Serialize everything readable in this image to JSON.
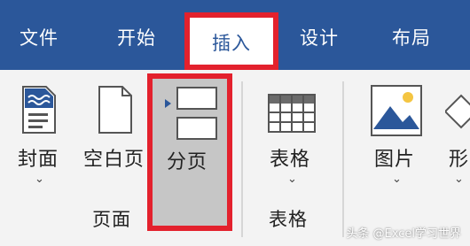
{
  "tabs": {
    "file": "文件",
    "home": "开始",
    "insert": "插入",
    "design": "设计",
    "layout": "布局"
  },
  "ribbon": {
    "groups": {
      "pages": {
        "label": "页面",
        "buttons": {
          "cover": "封面",
          "blank": "空白页",
          "page_break": "分页"
        }
      },
      "tables": {
        "label": "表格",
        "buttons": {
          "table": "表格"
        }
      },
      "illustrations": {
        "buttons": {
          "picture": "图片",
          "shapes": "形"
        }
      }
    }
  },
  "watermark": "头条 @Excel学习世界",
  "colors": {
    "tab_bar": "#2b579a",
    "highlight": "#e3212d",
    "ribbon_bg": "#f3f3f3",
    "icon_blue": "#2b579a"
  }
}
